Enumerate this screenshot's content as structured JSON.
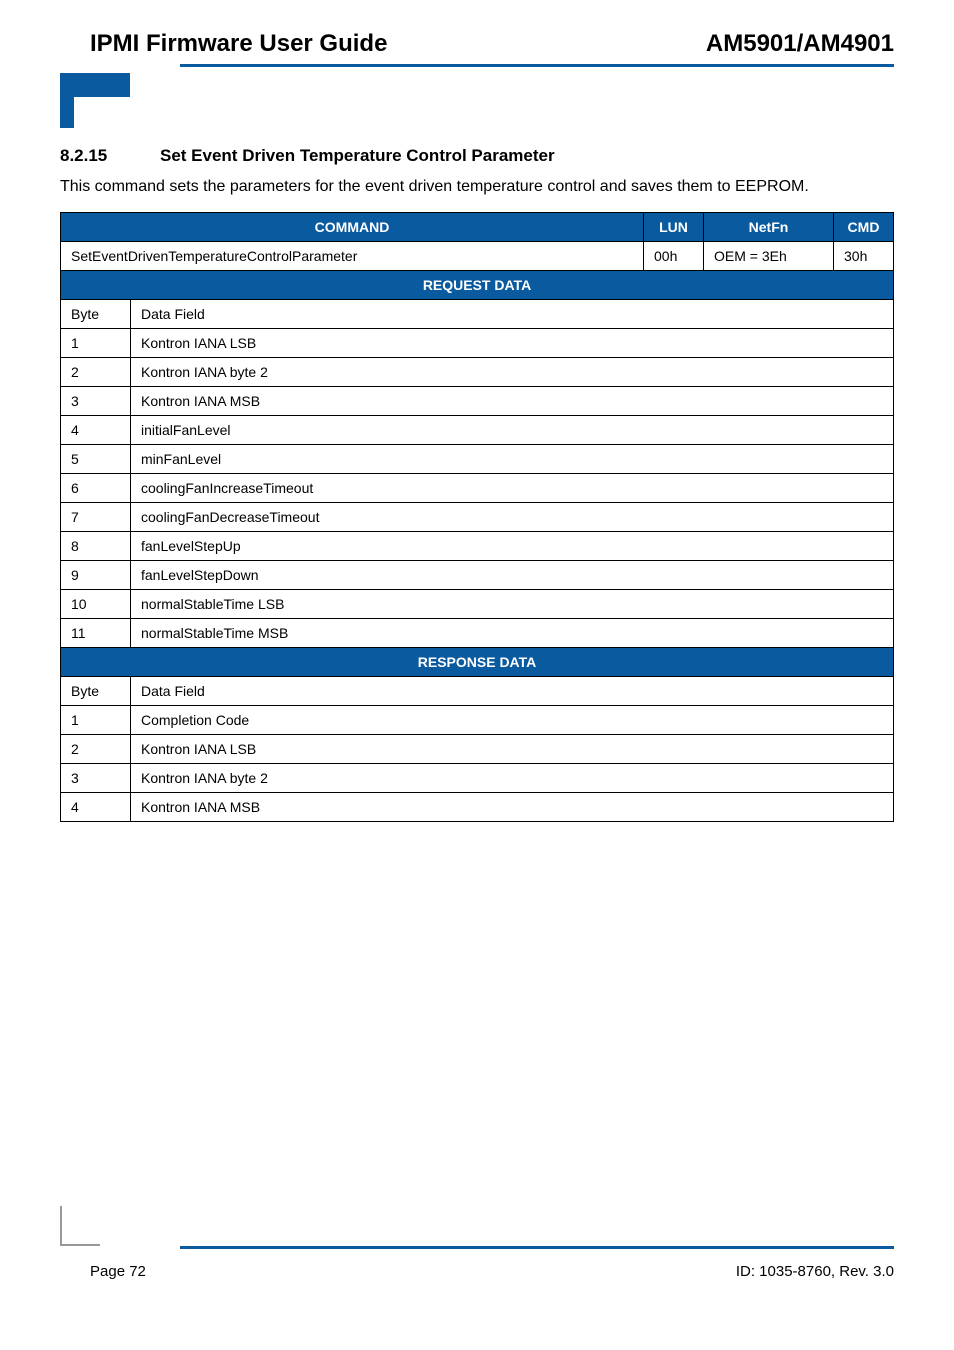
{
  "header": {
    "left": "IPMI Firmware User Guide",
    "right": "AM5901/AM4901"
  },
  "section": {
    "number": "8.2.15",
    "title": "Set Event Driven Temperature Control Parameter"
  },
  "body": "This command sets the parameters for the event driven temperature control and saves them to EEPROM.",
  "table": {
    "head": {
      "c0": "COMMAND",
      "c1": "LUN",
      "c2": "NetFn",
      "c3": "CMD"
    },
    "cmdrow": {
      "name": "SetEventDrivenTemperatureControlParameter",
      "lun": "00h",
      "netfn": "OEM = 3Eh",
      "cmd": "30h"
    },
    "request_label": "REQUEST DATA",
    "request_head": {
      "byte": "Byte",
      "field": "Data Field"
    },
    "request_rows": [
      {
        "byte": "1",
        "field": "Kontron IANA LSB"
      },
      {
        "byte": "2",
        "field": "Kontron IANA byte 2"
      },
      {
        "byte": "3",
        "field": "Kontron IANA MSB"
      },
      {
        "byte": "4",
        "field": "initialFanLevel"
      },
      {
        "byte": "5",
        "field": "minFanLevel"
      },
      {
        "byte": "6",
        "field": "coolingFanIncreaseTimeout"
      },
      {
        "byte": "7",
        "field": "coolingFanDecreaseTimeout"
      },
      {
        "byte": "8",
        "field": "fanLevelStepUp"
      },
      {
        "byte": "9",
        "field": "fanLevelStepDown"
      },
      {
        "byte": "10",
        "field": "normalStableTime LSB"
      },
      {
        "byte": "11",
        "field": "normalStableTime MSB"
      }
    ],
    "response_label": "RESPONSE DATA",
    "response_head": {
      "byte": "Byte",
      "field": "Data Field"
    },
    "response_rows": [
      {
        "byte": "1",
        "field": "Completion Code"
      },
      {
        "byte": "2",
        "field": "Kontron IANA LSB"
      },
      {
        "byte": "3",
        "field": "Kontron IANA byte 2"
      },
      {
        "byte": "4",
        "field": "Kontron IANA MSB"
      }
    ]
  },
  "footer": {
    "left": "Page 72",
    "right": "ID: 1035-8760, Rev. 3.0"
  }
}
